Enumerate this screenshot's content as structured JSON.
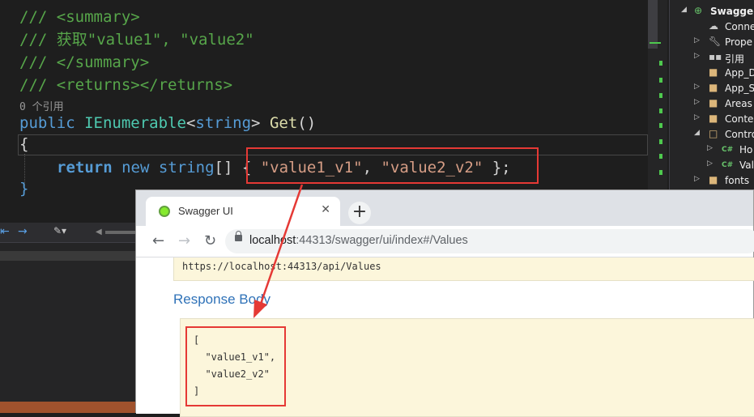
{
  "editor": {
    "lines": {
      "summary_open": "/// <summary>",
      "summary_text": "/// 获取\"value1\", \"value2\"",
      "summary_close": "/// </summary>",
      "returns": "/// <returns></returns>",
      "refs": "0 个引用",
      "sig_public": "public",
      "sig_type": "IEnumerable",
      "sig_lt": "<",
      "sig_string": "string",
      "sig_gt": ">",
      "sig_name": "Get",
      "sig_parens": "()",
      "brace_open": "{",
      "ret_kw": "return",
      "ret_new": "new",
      "ret_string": "string",
      "ret_arr": "[] { ",
      "ret_v1": "\"value1_v1\"",
      "ret_comma": ", ",
      "ret_v2": "\"value2_v2\"",
      "ret_end": " };",
      "brace_close": "}"
    }
  },
  "explorer": {
    "items": [
      {
        "label": "Swagger",
        "bold": true
      },
      {
        "label": "Conne"
      },
      {
        "label": "Prope"
      },
      {
        "label": "引用"
      },
      {
        "label": "App_D"
      },
      {
        "label": "App_S"
      },
      {
        "label": "Areas"
      },
      {
        "label": "Conter"
      },
      {
        "label": "Contro"
      },
      {
        "label": "Ho"
      },
      {
        "label": "Val"
      },
      {
        "label": "fonts"
      }
    ]
  },
  "browser": {
    "tab_title": "Swagger UI",
    "tab_close": "✕",
    "new_tab": "+",
    "url_host": "localhost",
    "url_path": ":44313/swagger/ui/index#/Values",
    "request_url": "https://localhost:44313/api/Values",
    "response_heading": "Response Body",
    "response_body": "[\n  \"value1_v1\",\n  \"value2_v2\"\n]"
  },
  "colors": {
    "annotation": "#e53935",
    "swagger_green": "#85ea2d",
    "heading_blue": "#2f72b8"
  }
}
